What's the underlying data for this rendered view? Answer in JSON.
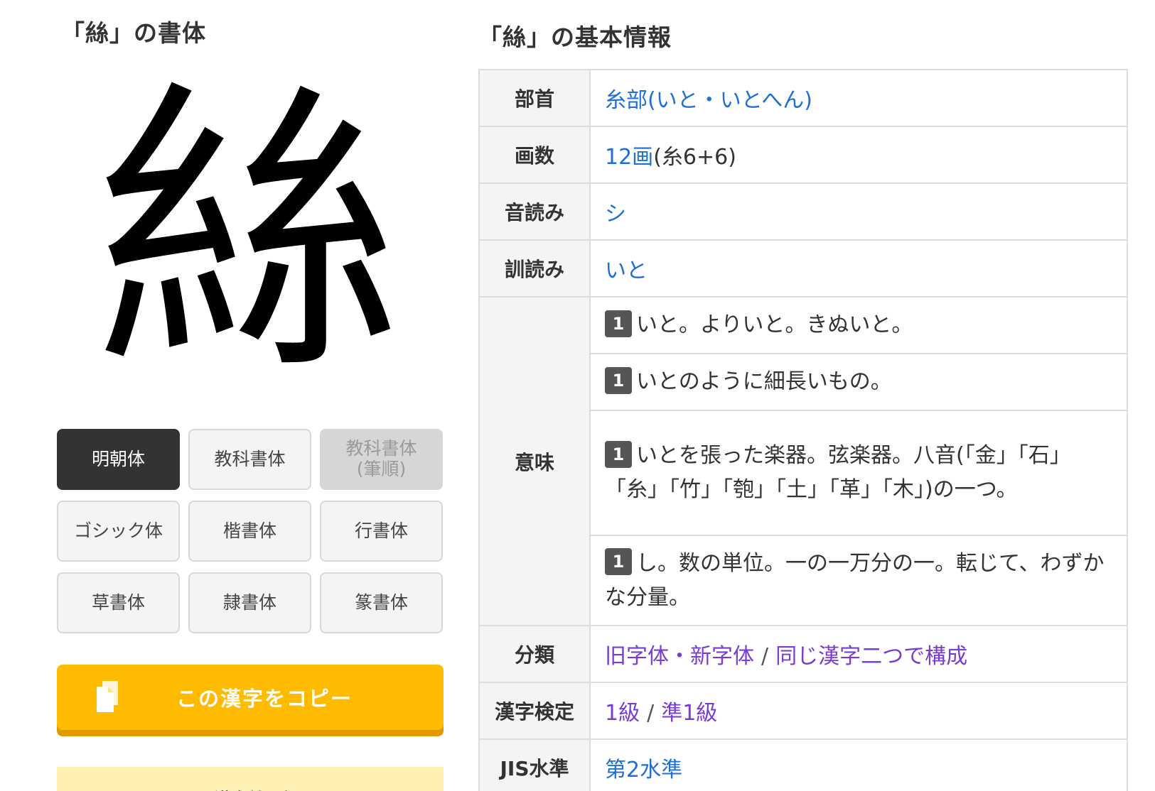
{
  "left_section": {
    "title": "「絲」の書体",
    "kanji": "絲",
    "font_buttons": [
      {
        "label": "明朝体",
        "state": "active"
      },
      {
        "label": "教科書体",
        "state": "normal"
      },
      {
        "label": "教科書体",
        "label2": "(筆順)",
        "state": "disabled"
      },
      {
        "label": "ゴシック体",
        "state": "normal"
      },
      {
        "label": "楷書体",
        "state": "normal"
      },
      {
        "label": "行書体",
        "state": "normal"
      },
      {
        "label": "草書体",
        "state": "normal"
      },
      {
        "label": "隷書体",
        "state": "normal"
      },
      {
        "label": "篆書体",
        "state": "normal"
      }
    ],
    "copy_button": {
      "label": "この漢字をコピー"
    },
    "bottom_banner": {
      "label": "NEW 漢字練習帳"
    }
  },
  "right_section": {
    "title": "「絲」の基本情報",
    "rows": {
      "bushu": {
        "header": "部首",
        "value": "糸部(いと・いとへん)"
      },
      "kakusu": {
        "header": "画数",
        "value_link": "12画",
        "value_rest": "(糸6+6)"
      },
      "on": {
        "header": "音読み",
        "value": "シ"
      },
      "kun": {
        "header": "訓読み",
        "value": "いと"
      },
      "imi": {
        "header": "意味",
        "items": [
          {
            "badge": "1",
            "text": "いと。よりいと。きぬいと。"
          },
          {
            "badge": "1",
            "text": "いとのように細長いもの。"
          },
          {
            "badge": "1",
            "text": "いとを張った楽器。弦楽器。八音(「金」「石」「糸」「竹」「匏」「土」「革」「木」)の一つ。"
          },
          {
            "badge": "1",
            "text": "し。数の単位。一の一万分の一。転じて、わずかな分量。"
          }
        ]
      },
      "bunrui": {
        "header": "分類",
        "value_a": "旧字体・新字体",
        "separator": "/",
        "value_b": "同じ漢字二つで構成"
      },
      "kentei": {
        "header": "漢字検定",
        "value_a": "1級",
        "separator": "/",
        "value_b": "準1級"
      },
      "jis": {
        "header": "JIS水準",
        "value": "第2水準"
      }
    }
  },
  "colors": {
    "active_button": "#333333",
    "copy_button": "#ffbb00",
    "link": "#1e6fd6",
    "visited_link": "#7a3bd0",
    "badge": "#555555"
  }
}
